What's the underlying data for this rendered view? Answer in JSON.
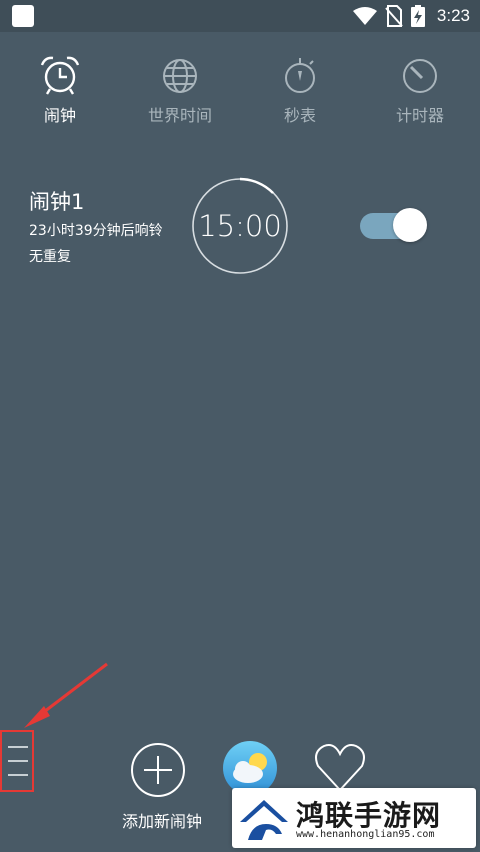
{
  "status_bar": {
    "time": "3:23",
    "icons": [
      "notification-square-icon",
      "wifi-icon",
      "no-sim-icon",
      "battery-charging-icon"
    ]
  },
  "tabs": [
    {
      "label": "闹钟",
      "icon": "alarm-clock-icon",
      "active": true
    },
    {
      "label": "世界时间",
      "icon": "globe-icon",
      "active": false
    },
    {
      "label": "秒表",
      "icon": "stopwatch-icon",
      "active": false
    },
    {
      "label": "计时器",
      "icon": "timer-icon",
      "active": false
    }
  ],
  "alarm": {
    "title": "闹钟1",
    "countdown": "23小时39分钟后响铃",
    "repeat": "无重复",
    "time": "15:00",
    "enabled": true
  },
  "bottom_bar": {
    "add_label": "添加新闹钟",
    "icons": [
      "plus-circle-icon",
      "weather-icon",
      "heart-icon"
    ]
  },
  "watermark": {
    "title": "鸿联手游网",
    "url": "www.henanhonglian95.com"
  },
  "colors": {
    "background": "#495a66",
    "statusbar": "#3f4e58",
    "toggle_track": "#7aa6be",
    "annotation_red": "#e53935"
  }
}
